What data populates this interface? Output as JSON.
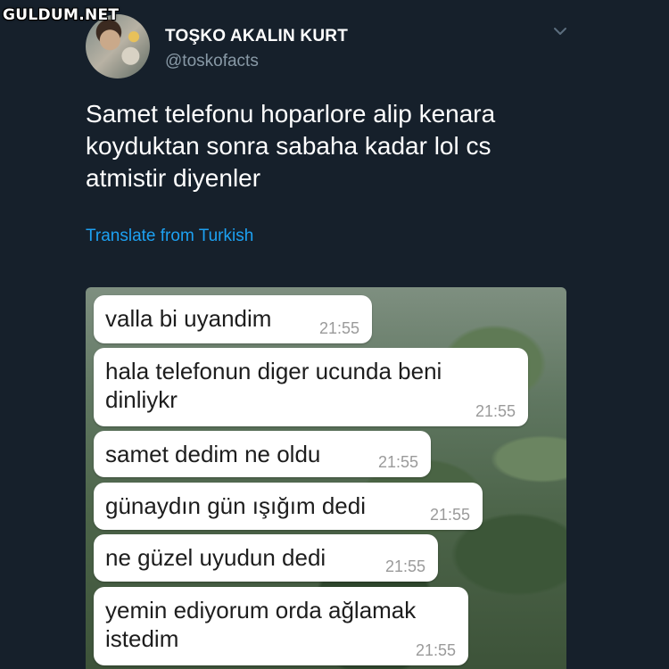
{
  "watermark": "GULDUM.NET",
  "tweet": {
    "display_name": "TOŞKO AKALIN KURT",
    "handle": "@toskofacts",
    "text": "Samet telefonu hoparlore alip kenara\nkoyduktan sonra sabaha kadar lol cs\natmistir diyenler",
    "translate_label": "Translate from Turkish"
  },
  "chat": {
    "messages": [
      {
        "text": "valla bi uyandim",
        "time": "21:55"
      },
      {
        "text": "hala telefonun diger ucunda beni\ndinliykr",
        "time": "21:55"
      },
      {
        "text": "samet dedim ne oldu",
        "time": "21:55"
      },
      {
        "text": "günaydın gün ışığım dedi",
        "time": "21:55"
      },
      {
        "text": "ne güzel uyudun dedi",
        "time": "21:55"
      },
      {
        "text": "yemin ediyorum orda ağlamak\nistedim",
        "time": "21:55"
      }
    ]
  },
  "colors": {
    "background": "#16202b",
    "link": "#1da1f2",
    "secondary_text": "#8899a6"
  },
  "icons": {
    "menu": "chevron-down-icon"
  }
}
